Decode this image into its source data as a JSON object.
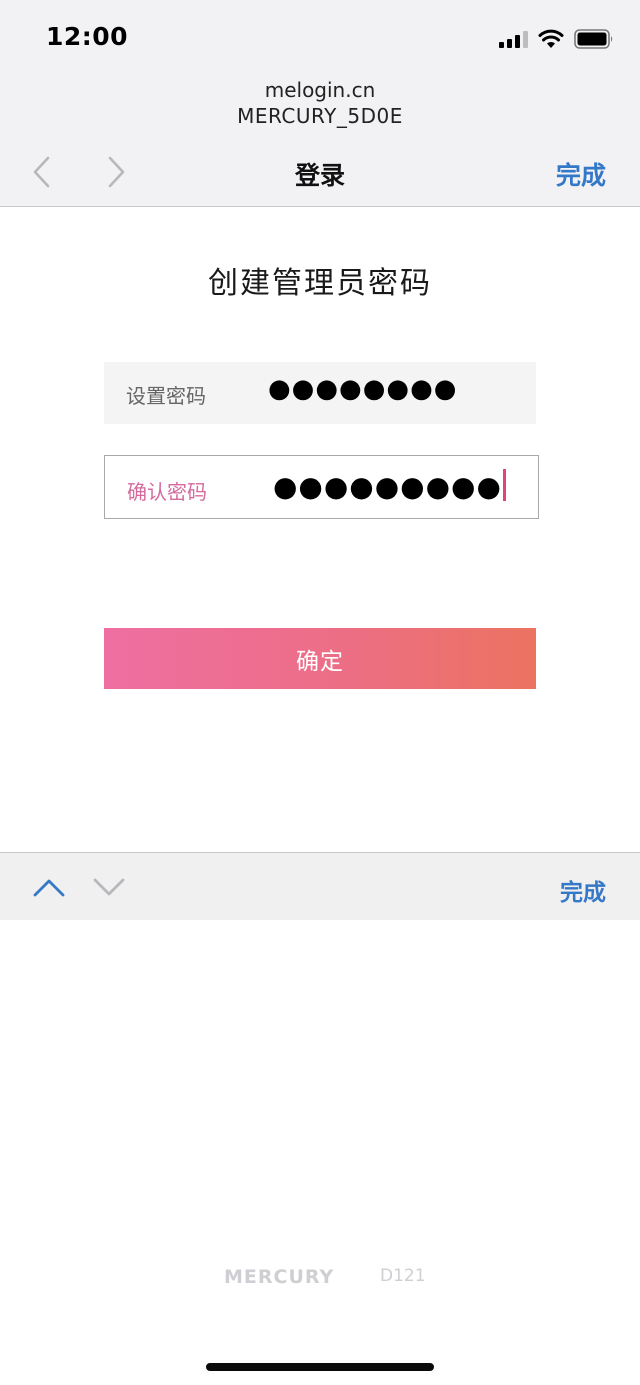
{
  "status_bar": {
    "time": "12:00",
    "icons": [
      "cellular-signal-icon",
      "wifi-icon",
      "battery-icon"
    ]
  },
  "browser": {
    "host": "melogin.cn",
    "network_name": "MERCURY_5D0E",
    "nav_title": "登录",
    "done_label": "完成",
    "back_icon": "chevron-left-icon",
    "forward_icon": "chevron-right-icon"
  },
  "form": {
    "title": "创建管理员密码",
    "password_label": "设置密码",
    "password_value": "●●●●●●●●",
    "confirm_label": "确认密码",
    "confirm_value": "●●●●●●●●●",
    "submit_label": "确定"
  },
  "keyboard_bar": {
    "prev_icon": "chevron-up-icon",
    "next_icon": "chevron-down-icon",
    "done_label": "完成"
  },
  "footer": {
    "brand": "MERCURY",
    "model": "D121"
  },
  "colors": {
    "link_blue": "#3478c8",
    "button_gradient_start": "#ef6fa2",
    "button_gradient_end": "#ec7360",
    "focus_label": "#d46a9e",
    "cursor": "#e0457a"
  }
}
